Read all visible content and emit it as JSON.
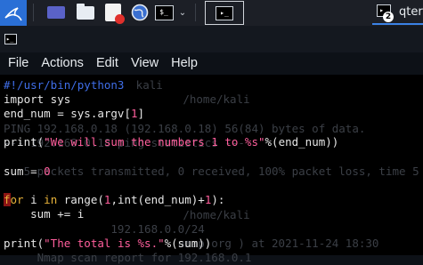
{
  "taskbar": {
    "apps": [
      {
        "name": "kali-menu"
      },
      {
        "name": "show-desktop"
      },
      {
        "name": "file-manager"
      },
      {
        "name": "text-editor"
      },
      {
        "name": "web-browser"
      },
      {
        "name": "terminal"
      }
    ],
    "terminal_glyph": "$_",
    "window_badge": "2",
    "window_title": "qter"
  },
  "menubar": [
    "File",
    "Actions",
    "Edit",
    "View",
    "Help"
  ],
  "code": {
    "line1": "#!/usr/bin/python3",
    "line2": "import sys",
    "line3a": "end_num = sys.argv[",
    "line3b": "1",
    "line3c": "]",
    "line4a": "print(",
    "line4b": "\"We will sum the numbers 1 to %s\"",
    "line4c": "%(end_num))",
    "line5a": "sum = ",
    "line5b": "0",
    "line6a": "f",
    "line6b": "or",
    "line6c": " i ",
    "line6d": "in",
    "line6e": " range(",
    "line6f": "1",
    "line6g": ",int(end_num)+",
    "line6h": "1",
    "line6i": "):",
    "line7": "    sum += i",
    "line8a": "print(",
    "line8b": "\"The total is %s.\"",
    "line8c": "%(sum))"
  },
  "ghost_text": {
    "g1": "       kali",
    "g2": "              /home/kali",
    "g3": "PING 192.168.0.18 (192.168.0.18) 56(84) bytes of data.",
    "g4": "--- 192.168.0.18 ping statistics ---",
    "g5": "   5 packets transmitted, 0 received, 100% packet loss, time 5",
    "g6": "              /home/kali",
    "g7": "                192.168.0.0/24",
    "g8": "                          nmap.org ) at 2021-11-24 18:30",
    "g9": "     Nmap scan report for 192.168.0.1"
  }
}
